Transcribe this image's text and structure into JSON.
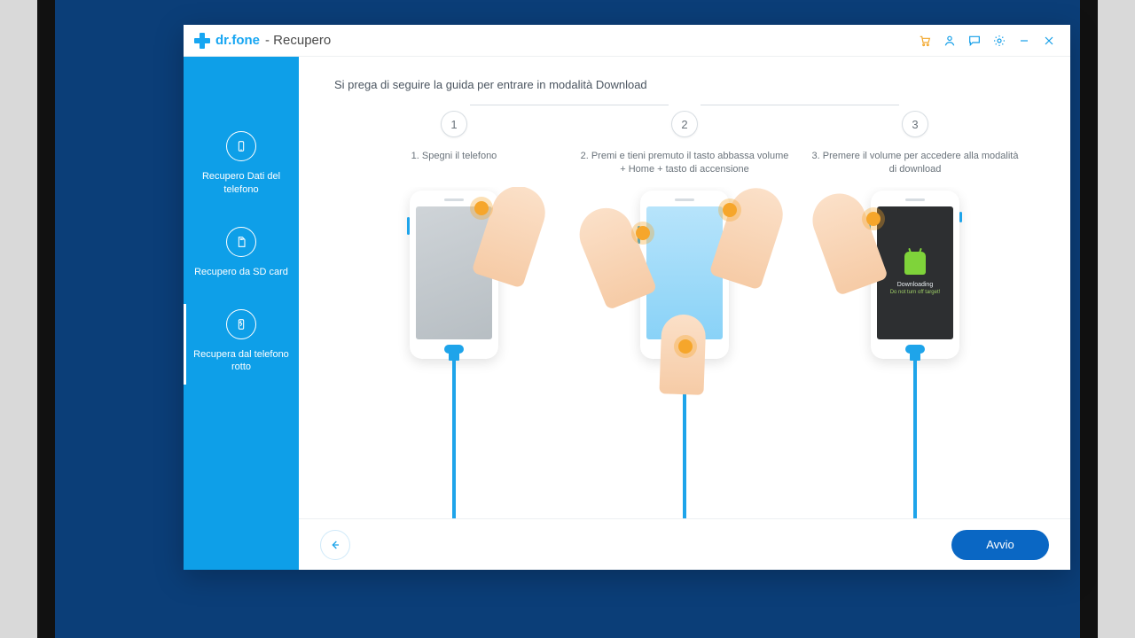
{
  "titlebar": {
    "brand": "dr.fone",
    "module": "- Recupero"
  },
  "sidebar": {
    "items": [
      {
        "label": "Recupero Dati del telefono"
      },
      {
        "label": "Recupero da SD card"
      },
      {
        "label": "Recupera dal telefono rotto"
      }
    ]
  },
  "main": {
    "guide_title": "Si prega di seguire la guida per entrare in modalità Download",
    "steps": [
      {
        "num": "1",
        "text": "1. Spegni il telefono"
      },
      {
        "num": "2",
        "text": "2. Premi e tieni premuto il tasto abbassa volume + Home + tasto di accensione"
      },
      {
        "num": "3",
        "text": "3. Premere il volume per accedere alla modalità di download"
      }
    ],
    "phone3": {
      "line1": "Downloading",
      "line2": "Do not turn off target!"
    }
  },
  "footer": {
    "primary": "Avvio"
  }
}
